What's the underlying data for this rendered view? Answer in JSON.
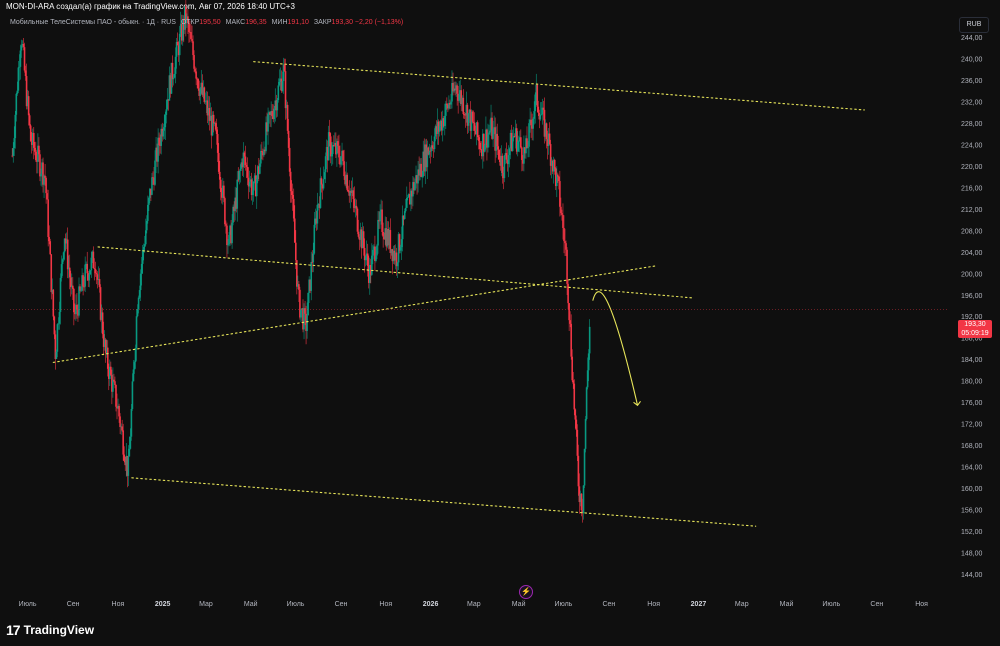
{
  "header": {
    "caption": "MON-DI-ARA создал(а) график на TradingView.com, Авг 07, 2026 18:40 UTC+3"
  },
  "legend": {
    "symbol": "Мобильные ТелеСистемы ПАО - обыкн. · 1Д · RUS",
    "open_label": "ОТКР",
    "open": "195,50",
    "high_label": "МАКС",
    "high": "196,35",
    "low_label": "МИН",
    "low": "191,10",
    "close_label": "ЗАКР",
    "close": "193,30",
    "change": "−2,20 (−1,13%)"
  },
  "currency": "RUB",
  "price_tag": {
    "price": "193,30",
    "countdown": "05:09:19"
  },
  "brand": {
    "name": "TradingView",
    "logo_mark": "17"
  },
  "colors": {
    "background": "#0f0f0f",
    "up": "#089981",
    "down": "#f23645",
    "trendline": "#e8e65a",
    "projection": "#e8e65a",
    "axis_text": "#b2b5be",
    "last_price_line": "#f23645"
  },
  "chart_data": {
    "type": "candlestick",
    "price_axis": {
      "min": 140,
      "max": 248,
      "ticks": [
        144,
        148,
        152,
        156,
        160,
        164,
        168,
        172,
        176,
        180,
        184,
        188,
        192,
        196,
        200,
        204,
        208,
        212,
        216,
        220,
        224,
        228,
        232,
        236,
        240,
        244
      ],
      "tick_labels": [
        "144,00",
        "148,00",
        "152,00",
        "156,00",
        "160,00",
        "164,00",
        "168,00",
        "172,00",
        "176,00",
        "180,00",
        "184,00",
        "188,00",
        "192,00",
        "196,00",
        "200,00",
        "204,00",
        "208,00",
        "212,00",
        "216,00",
        "220,00",
        "224,00",
        "228,00",
        "232,00",
        "236,00",
        "240,00",
        "244,00"
      ]
    },
    "time_axis": {
      "start": "2024-06-07",
      "end": "2027-12-07",
      "ticks": [
        {
          "date": "2024-07-01",
          "label": "Июль"
        },
        {
          "date": "2024-09-01",
          "label": "Сен"
        },
        {
          "date": "2024-11-01",
          "label": "Ноя"
        },
        {
          "date": "2025-01-01",
          "label": "2025"
        },
        {
          "date": "2025-03-01",
          "label": "Мар"
        },
        {
          "date": "2025-05-01",
          "label": "Май"
        },
        {
          "date": "2025-07-01",
          "label": "Июль"
        },
        {
          "date": "2025-09-01",
          "label": "Сен"
        },
        {
          "date": "2025-11-01",
          "label": "Ноя"
        },
        {
          "date": "2026-01-01",
          "label": "2026"
        },
        {
          "date": "2026-03-01",
          "label": "Мар"
        },
        {
          "date": "2026-05-01",
          "label": "Май"
        },
        {
          "date": "2026-07-01",
          "label": "Июль"
        },
        {
          "date": "2026-09-01",
          "label": "Сен"
        },
        {
          "date": "2026-11-01",
          "label": "Ноя"
        },
        {
          "date": "2027-01-01",
          "label": "2027"
        },
        {
          "date": "2027-03-01",
          "label": "Мар"
        },
        {
          "date": "2027-05-01",
          "label": "Май"
        },
        {
          "date": "2027-07-01",
          "label": "Июль"
        },
        {
          "date": "2027-09-01",
          "label": "Сен"
        },
        {
          "date": "2027-11-01",
          "label": "Ноя"
        }
      ]
    },
    "last_price": 193.3,
    "price_path": [
      {
        "date": "2024-06-10",
        "price": 222
      },
      {
        "date": "2024-06-22",
        "price": 245
      },
      {
        "date": "2024-07-05",
        "price": 225
      },
      {
        "date": "2024-07-25",
        "price": 218
      },
      {
        "date": "2024-08-08",
        "price": 185
      },
      {
        "date": "2024-08-20",
        "price": 208
      },
      {
        "date": "2024-09-03",
        "price": 192
      },
      {
        "date": "2024-09-18",
        "price": 200
      },
      {
        "date": "2024-10-01",
        "price": 203
      },
      {
        "date": "2024-10-15",
        "price": 185
      },
      {
        "date": "2024-11-01",
        "price": 175
      },
      {
        "date": "2024-11-15",
        "price": 163
      },
      {
        "date": "2024-11-28",
        "price": 196
      },
      {
        "date": "2024-12-15",
        "price": 215
      },
      {
        "date": "2025-01-10",
        "price": 235
      },
      {
        "date": "2025-02-01",
        "price": 248
      },
      {
        "date": "2025-02-20",
        "price": 235
      },
      {
        "date": "2025-03-15",
        "price": 225
      },
      {
        "date": "2025-04-01",
        "price": 205
      },
      {
        "date": "2025-04-20",
        "price": 222
      },
      {
        "date": "2025-05-05",
        "price": 215
      },
      {
        "date": "2025-05-20",
        "price": 225
      },
      {
        "date": "2025-06-15",
        "price": 238
      },
      {
        "date": "2025-07-05",
        "price": 195
      },
      {
        "date": "2025-07-15",
        "price": 190
      },
      {
        "date": "2025-07-30",
        "price": 212
      },
      {
        "date": "2025-08-15",
        "price": 224
      },
      {
        "date": "2025-09-01",
        "price": 222
      },
      {
        "date": "2025-09-20",
        "price": 212
      },
      {
        "date": "2025-10-10",
        "price": 200
      },
      {
        "date": "2025-10-25",
        "price": 210
      },
      {
        "date": "2025-11-15",
        "price": 203
      },
      {
        "date": "2025-12-05",
        "price": 215
      },
      {
        "date": "2025-12-25",
        "price": 222
      },
      {
        "date": "2026-01-15",
        "price": 228
      },
      {
        "date": "2026-02-05",
        "price": 235
      },
      {
        "date": "2026-02-20",
        "price": 230
      },
      {
        "date": "2026-03-10",
        "price": 224
      },
      {
        "date": "2026-03-25",
        "price": 227
      },
      {
        "date": "2026-04-10",
        "price": 220
      },
      {
        "date": "2026-04-25",
        "price": 226
      },
      {
        "date": "2026-05-10",
        "price": 222
      },
      {
        "date": "2026-05-25",
        "price": 233
      },
      {
        "date": "2026-06-10",
        "price": 225
      },
      {
        "date": "2026-06-25",
        "price": 215
      },
      {
        "date": "2026-07-05",
        "price": 203
      },
      {
        "date": "2026-07-12",
        "price": 185
      },
      {
        "date": "2026-07-22",
        "price": 160
      },
      {
        "date": "2026-07-27",
        "price": 157
      },
      {
        "date": "2026-08-01",
        "price": 176
      },
      {
        "date": "2026-08-05",
        "price": 188
      },
      {
        "date": "2026-08-07",
        "price": 193.3
      }
    ],
    "trendlines": [
      {
        "name": "upper-channel",
        "from": {
          "date": "2025-05-05",
          "price": 239.5
        },
        "to": {
          "date": "2027-08-15",
          "price": 230.5
        }
      },
      {
        "name": "lower-channel",
        "from": {
          "date": "2024-11-20",
          "price": 162
        },
        "to": {
          "date": "2027-03-20",
          "price": 153
        }
      },
      {
        "name": "middle-descending",
        "from": {
          "date": "2024-10-05",
          "price": 205
        },
        "to": {
          "date": "2026-12-25",
          "price": 195.5
        }
      },
      {
        "name": "rising-support",
        "from": {
          "date": "2024-08-05",
          "price": 183.5
        },
        "to": {
          "date": "2026-11-05",
          "price": 201.5
        }
      }
    ],
    "projection": {
      "from": {
        "date": "2026-08-10",
        "price": 195
      },
      "peak": {
        "date": "2026-08-25",
        "price": 198.5
      },
      "to": {
        "date": "2026-10-10",
        "price": 175.5
      }
    },
    "grid": false
  }
}
